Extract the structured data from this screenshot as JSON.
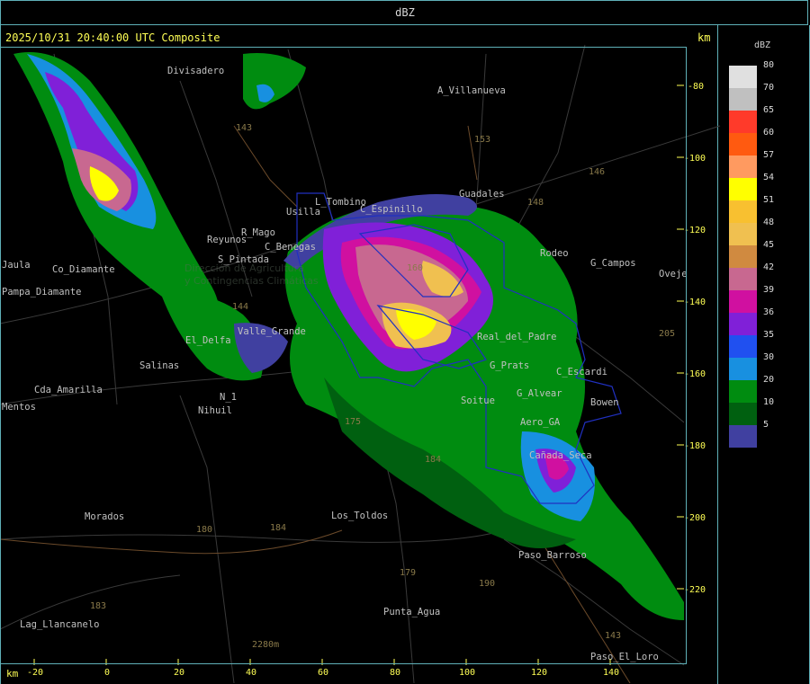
{
  "header": {
    "unit": "dBZ"
  },
  "map": {
    "timestamp": "2025/10/31 20:40:00 UTC Composite",
    "km_label_top": "km",
    "km_label_bottom": "km",
    "watermark_line1": "Dirección de Agricultura",
    "watermark_line2": "y Contingencias Climáticas",
    "x_ticks": [
      "-20",
      "0",
      "20",
      "40",
      "60",
      "80",
      "100",
      "120",
      "140"
    ],
    "y_ticks": [
      "-80",
      "-100",
      "-120",
      "-140",
      "-160",
      "-180",
      "-200",
      "-220"
    ],
    "places": [
      "Divisadero",
      "A_Villanueva",
      "Usilla",
      "L_Tombino",
      "C_Espinillo",
      "Guadales",
      "Rodeo",
      "G_Campos",
      "Oveje",
      "Reyunos",
      "R_Mago",
      "C_Benegas",
      "S_Pintada",
      "Pampa_Diamante",
      "Real_del_Padre",
      "El_Delfa",
      "Valle_Grande",
      "Salinas",
      "Cda_Amarilla",
      "N_1",
      "Nihuil",
      "Soitue",
      "G_Prats",
      "G_Alvear",
      "Cañada_Seca",
      "Bowen",
      "C_Escardi",
      "Aero_GA",
      "Morados",
      "Los_Toldos",
      "Paso_Barroso",
      "Punta_Agua",
      "Lag_Llancanelo",
      "Paso_El_Loro",
      "Jaula",
      "Mentos",
      "Co_Diamante"
    ],
    "routes": [
      "143",
      "153",
      "146",
      "148",
      "160",
      "144",
      "175",
      "184",
      "180",
      "179",
      "190",
      "183",
      "143",
      "205",
      "2280m",
      "184"
    ]
  },
  "legend": {
    "title": "dBZ",
    "levels": [
      {
        "value": "80",
        "color": "#e0e0e0"
      },
      {
        "value": "70",
        "color": "#c0c0c0"
      },
      {
        "value": "65",
        "color": "#ff3a2a"
      },
      {
        "value": "60",
        "color": "#ff5a10"
      },
      {
        "value": "57",
        "color": "#ff9a60"
      },
      {
        "value": "54",
        "color": "#ffff00"
      },
      {
        "value": "51",
        "color": "#f8c030"
      },
      {
        "value": "48",
        "color": "#f0c050"
      },
      {
        "value": "45",
        "color": "#d08a40"
      },
      {
        "value": "42",
        "color": "#c86890"
      },
      {
        "value": "39",
        "color": "#d010a0"
      },
      {
        "value": "36",
        "color": "#8020d8"
      },
      {
        "value": "35",
        "color": "#2050f0"
      },
      {
        "value": "30",
        "color": "#1890e0"
      },
      {
        "value": "20",
        "color": "#008c10"
      },
      {
        "value": "10",
        "color": "#006010"
      },
      {
        "value": "5",
        "color": "#4040a0"
      }
    ]
  }
}
